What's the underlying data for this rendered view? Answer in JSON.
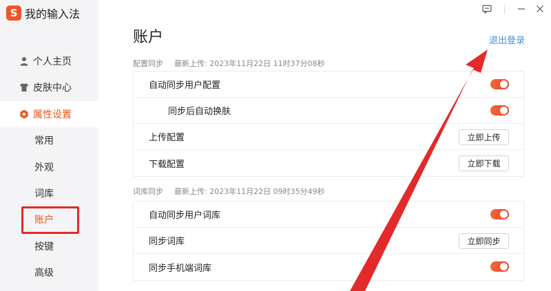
{
  "app": {
    "logo_char": "S",
    "name": "我的输入法"
  },
  "sidebar": {
    "items": [
      {
        "label": "个人主页"
      },
      {
        "label": "皮肤中心"
      },
      {
        "label": "属性设置"
      }
    ],
    "subitems": [
      {
        "label": "常用"
      },
      {
        "label": "外观"
      },
      {
        "label": "词库"
      },
      {
        "label": "账户"
      },
      {
        "label": "按键"
      },
      {
        "label": "高级"
      }
    ]
  },
  "page": {
    "title": "账户",
    "logout": "退出登录"
  },
  "config_sync": {
    "section": "配置同步",
    "last_upload": "最新上传: 2023年11月22日 11时37分08秒",
    "rows": [
      {
        "label": "自动同步用户配置",
        "control": "toggle",
        "on": true
      },
      {
        "label": "同步后自动换肤",
        "control": "toggle",
        "on": true
      },
      {
        "label": "上传配置",
        "control": "button",
        "button": "立即上传"
      },
      {
        "label": "下载配置",
        "control": "button",
        "button": "立即下载"
      }
    ]
  },
  "lexicon_sync": {
    "section": "词库同步",
    "last_upload": "最新上传: 2023年11月22日 09时35分49秒",
    "rows": [
      {
        "label": "自动同步用户词库",
        "control": "toggle",
        "on": true
      },
      {
        "label": "同步词库",
        "control": "button",
        "button": "立即同步"
      },
      {
        "label": "同步手机端词库",
        "control": "toggle",
        "on": true
      }
    ]
  },
  "colors": {
    "accent": "#e8571e",
    "toggle": "#ec4f2e",
    "link": "#4a8fcf",
    "annotation": "#e32a2a"
  }
}
